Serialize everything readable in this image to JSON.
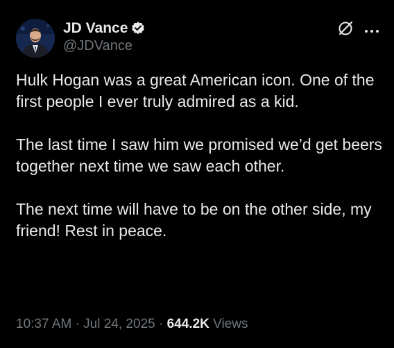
{
  "author": {
    "display_name": "JD Vance",
    "handle": "@JDVance",
    "verified": true,
    "verified_color": "#1d9bf0"
  },
  "actions": {
    "grok_icon": "grok-icon",
    "more_icon": "more-horizontal-icon"
  },
  "tweet": {
    "paragraphs": [
      "Hulk Hogan was a great American icon. One of the first people I ever truly admired as a kid.",
      "The last time I saw him we promised we’d get beers together next time we saw each other.",
      "The next time will have to be on the other side, my friend! Rest in peace."
    ]
  },
  "meta": {
    "time": "10:37 AM",
    "separator": " · ",
    "date": "Jul 24, 2025",
    "views_count": "644.2K",
    "views_label": " Views"
  },
  "colors": {
    "background": "#000000",
    "text": "#e7e9ea",
    "secondary": "#71767b"
  }
}
